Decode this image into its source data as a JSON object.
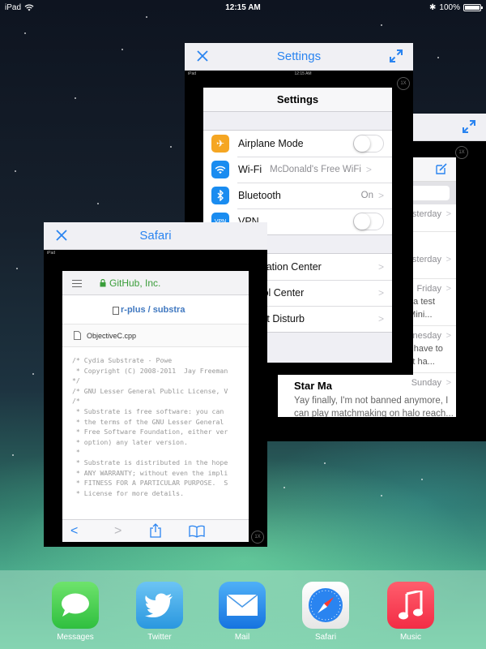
{
  "status_bar": {
    "device": "iPad",
    "time": "12:15 AM",
    "battery": "100%"
  },
  "mini_status": {
    "device": "iPad",
    "time": "12:15 AM"
  },
  "zoom_badge": "1X",
  "mail_card": {
    "rows": [
      {
        "date": "sterday"
      },
      {
        "date": "sterday"
      },
      {
        "date": "Friday",
        "snippets": [
          "eta test",
          "d Mini..."
        ]
      },
      {
        "date": "nesday",
        "snippets": [
          "ing have to",
          "on't ha..."
        ]
      },
      {
        "date": "Sunday",
        "from": "Star Ma",
        "body": [
          "Yay finally, I'm not banned anymore, I",
          "can play matchmaking on halo reach..."
        ]
      }
    ]
  },
  "settings_card": {
    "title": "Settings",
    "screen_title": "Settings",
    "group1": [
      {
        "label": "Airplane Mode",
        "icon": "airplane-icon",
        "color": "#f5a623",
        "toggle": false
      },
      {
        "label": "Wi-Fi",
        "icon": "wifi-icon",
        "color": "#1a8cf0",
        "value": "McDonald's Free WiFi"
      },
      {
        "label": "Bluetooth",
        "icon": "bluetooth-icon",
        "color": "#1a8cf0",
        "value": "On"
      },
      {
        "label": "VPN",
        "icon": "vpn-icon",
        "color": "#1a8cf0",
        "badge": "VPN",
        "toggle": false
      }
    ],
    "group2": [
      {
        "label": "Notification Center",
        "icon": "notification-center-icon",
        "color": "#8e8e93"
      },
      {
        "label": "Control Center",
        "icon": "control-center-icon",
        "color": "#8e8e93"
      },
      {
        "label": "Do Not Disturb",
        "icon": "moon-icon",
        "color": "#5856d6"
      }
    ]
  },
  "safari_card": {
    "title": "Safari",
    "url": "GitHub, Inc.",
    "breadcrumb": "r-plus / substra",
    "file": "ObjectiveC.cpp",
    "code": [
      "/* Cydia Substrate - Powe",
      " * Copyright (C) 2008-2011  Jay Freeman",
      "*/",
      "",
      "/* GNU Lesser General Public License, V",
      "/*",
      " * Substrate is free software: you can",
      " * the terms of the GNU Lesser General",
      " * Free Software Foundation, either ver",
      " * option) any later version.",
      " *",
      " * Substrate is distributed in the hope",
      " * ANY WARRANTY; without even the impli",
      " * FITNESS FOR A PARTICULAR PURPOSE.  S",
      " * License for more details."
    ]
  },
  "dock": [
    {
      "label": "Messages",
      "icon": "messages-icon",
      "color": "#3ecb4f"
    },
    {
      "label": "Twitter",
      "icon": "twitter-icon",
      "color": "#3aa7e8"
    },
    {
      "label": "Mail",
      "icon": "mail-icon",
      "color": "#1a8cf0"
    },
    {
      "label": "Safari",
      "icon": "safari-icon",
      "color": "#f4f4f4"
    },
    {
      "label": "Music",
      "icon": "music-icon",
      "color": "#fb3c52"
    }
  ]
}
